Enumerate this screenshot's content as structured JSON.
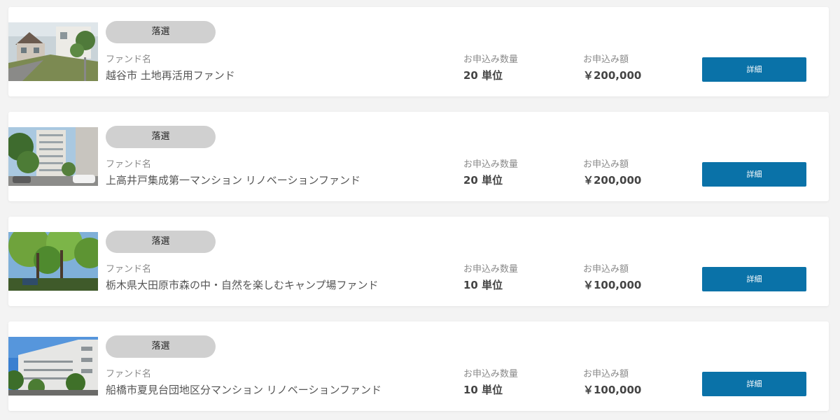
{
  "funds": [
    {
      "status": "落選",
      "fund_label": "ファンド名",
      "name": "越谷市 土地再活用ファンド",
      "quantity_label": "お申込み数量",
      "quantity": "20 単位",
      "amount_label": "お申込み額",
      "amount": "￥200,000",
      "button_label": "詳細"
    },
    {
      "status": "落選",
      "fund_label": "ファンド名",
      "name": "上高井戸集成第一マンション リノベーションファンド",
      "quantity_label": "お申込み数量",
      "quantity": "20 単位",
      "amount_label": "お申込み額",
      "amount": "￥200,000",
      "button_label": "詳細"
    },
    {
      "status": "落選",
      "fund_label": "ファンド名",
      "name": "栃木県大田原市森の中・自然を楽しむキャンプ場ファンド",
      "quantity_label": "お申込み数量",
      "quantity": "10 単位",
      "amount_label": "お申込み額",
      "amount": "￥100,000",
      "button_label": "詳細"
    },
    {
      "status": "落選",
      "fund_label": "ファンド名",
      "name": "船橋市夏見台団地区分マンション リノベーションファンド",
      "quantity_label": "お申込み数量",
      "quantity": "10 単位",
      "amount_label": "お申込み額",
      "amount": "￥100,000",
      "button_label": "詳細"
    }
  ],
  "colors": {
    "button": "#0a72a8",
    "badge": "#d0d0d0",
    "page_background": "#f3f3f3"
  }
}
